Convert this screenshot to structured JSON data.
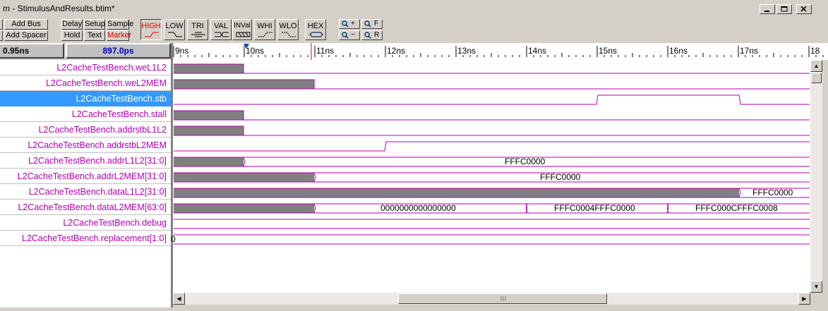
{
  "window": {
    "title": "m - StimulusAndResults.btim*"
  },
  "toolbar": {
    "add_bus": "Add Bus",
    "add_spacer": "Add Spacer",
    "delay": "Delay",
    "setup": "Setup",
    "sample": "Sample",
    "hold": "Hold",
    "text": "Text",
    "marker": "Marker",
    "levels": [
      "HIGH",
      "LOW",
      "TRI",
      "VAL",
      "INVal",
      "WHI",
      "WLO"
    ],
    "hex": "HEX",
    "zoom_in": "+",
    "zoom_out": "−",
    "zoom_full": "F",
    "zoom_range": "R"
  },
  "times": {
    "left": "0.95ns",
    "right": "897.0ps"
  },
  "ruler": {
    "labels": [
      "9ns",
      "10ns",
      "11ns",
      "12ns",
      "13ns",
      "14ns",
      "15ns",
      "16ns",
      "17ns",
      "18"
    ]
  },
  "signals": [
    {
      "name": "L2CacheTestBench.weL1L2"
    },
    {
      "name": "L2CacheTestBench.weL2MEM"
    },
    {
      "name": "L2CacheTestBench.stb"
    },
    {
      "name": "L2CacheTestBench.stall"
    },
    {
      "name": "L2CacheTestBench.addrstbL1L2"
    },
    {
      "name": "L2CacheTestBench.addrstbL2MEM"
    },
    {
      "name": "L2CacheTestBench.addrL1L2[31:0]"
    },
    {
      "name": "L2CacheTestBench.addrL2MEM[31:0]"
    },
    {
      "name": "L2CacheTestBench.dataL1L2[31:0]"
    },
    {
      "name": "L2CacheTestBench.dataL2MEM[63:0]"
    },
    {
      "name": "L2CacheTestBench.debug"
    },
    {
      "name": "L2CacheTestBench.replacement[1:0]"
    }
  ],
  "bus_values": {
    "addrL1L2": "FFFC0000",
    "addrL2MEM": "FFFC0000",
    "dataL1L2": "FFFC0000",
    "dataL2MEM_1": "0000000000000000",
    "dataL2MEM_2": "FFFC0004FFFC0000",
    "dataL2MEM_3": "FFFC000CFFFC0008",
    "replacement": "0"
  },
  "colors": {
    "wave": "#b000b0",
    "undefined": "#808080",
    "selection": "#3399ff",
    "marker": "#e00000"
  }
}
